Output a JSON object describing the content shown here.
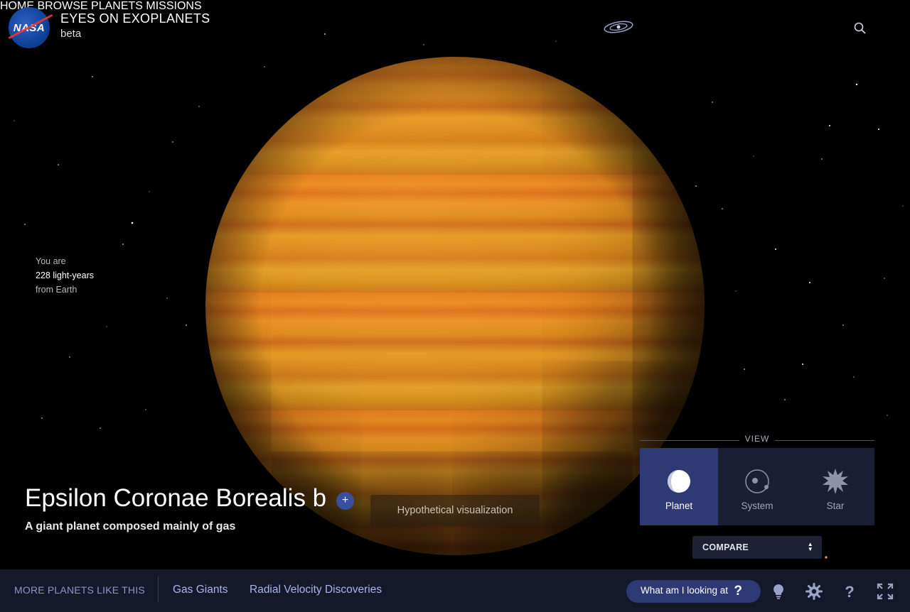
{
  "header": {
    "app_title": "EYES ON EXOPLANETS",
    "app_subtitle": "beta",
    "logo_text": "NASA",
    "nav": {
      "home": "HOME",
      "browse": "BROWSE PLANETS",
      "missions": "MISSIONS"
    },
    "icons": [
      "galaxy-icon",
      "search-icon"
    ]
  },
  "distance": {
    "prefix": "You are",
    "value": "228 light-years",
    "suffix": "from Earth"
  },
  "planet": {
    "name": "Epsilon Coronae Borealis b",
    "add_label": "+",
    "description": "A giant planet composed mainly of gas",
    "visualization_note": "Hypothetical visualization"
  },
  "view": {
    "label": "VIEW",
    "options": [
      {
        "label": "Planet",
        "icon": "planet-icon",
        "active": true
      },
      {
        "label": "System",
        "icon": "system-icon",
        "active": false
      },
      {
        "label": "Star",
        "icon": "star-icon",
        "active": false
      }
    ],
    "compare_label": "COMPARE"
  },
  "bottom_bar": {
    "more_label": "MORE PLANETS LIKE THIS",
    "links": [
      "Gas Giants",
      "Radial Velocity Discoveries"
    ],
    "help_label": "What am I looking at",
    "help_mark": "?",
    "tools": [
      "lightbulb-icon",
      "settings-icon",
      "help-icon",
      "fullscreen-icon"
    ]
  },
  "colors": {
    "accent": "#2d3a74",
    "bar": "#151829",
    "link": "#aab4ea",
    "planet": "#e08a20"
  }
}
